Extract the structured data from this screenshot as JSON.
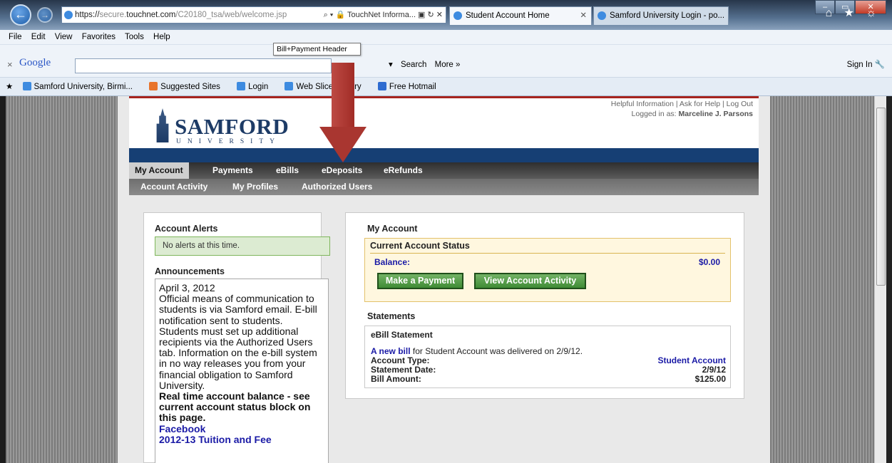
{
  "browser": {
    "address_prefix": "https://",
    "address_dim": "secure.",
    "address_domain": "touchnet.com",
    "address_path": "/C20180_tsa/web/welcome.jsp",
    "address_right": "⌕ ▾ 🔒 TouchNet Informa... ▣ ↻ ✕",
    "tabs": [
      {
        "label": "Student Account Home"
      },
      {
        "label": "Samford University Login - po..."
      }
    ],
    "window_buttons": [
      "–",
      "▭",
      "✕"
    ],
    "right_icons": "⌂ ★ ☼"
  },
  "menubar": {
    "items": [
      "File",
      "Edit",
      "View",
      "Favorites",
      "Tools",
      "Help"
    ]
  },
  "googlebar": {
    "close": "×",
    "logo": "Google",
    "search": "Search",
    "more": "More »",
    "signin": "Sign In"
  },
  "favorites": {
    "items": [
      {
        "label": "Samford University, Birmi...",
        "color": "#3d8be0"
      },
      {
        "label": "Suggested Sites",
        "color": "#e8742b"
      },
      {
        "label": "Login",
        "color": "#3d8be0"
      },
      {
        "label": "Web Slice Gallery",
        "color": "#3d8be0"
      },
      {
        "label": "Free Hotmail",
        "color": "#2d6bd0"
      }
    ]
  },
  "header": {
    "logo_name": "SAMFORD",
    "logo_sub": "UNIVERSITY",
    "links": "Helpful Information | Ask for Help | Log Out",
    "logged_in_label": "Logged in as:",
    "logged_in_user": "Marceline J. Parsons",
    "tooltip": "Bill+Payment Header"
  },
  "nav": {
    "tabs": [
      "My Account",
      "Payments",
      "eBills",
      "eDeposits",
      "eRefunds"
    ],
    "subtabs": [
      "Account Activity",
      "My Profiles",
      "Authorized Users"
    ]
  },
  "left": {
    "alerts_title": "Account Alerts",
    "alerts_text": "No alerts at this time.",
    "ann_title": "Announcements",
    "ann_date": "April 3, 2012",
    "ann_body": "Official means of communication to students is via Samford email. E-bill notification sent to students. Students must set up additional recipients via the Authorized Users tab. Information on the e-bill system in no way releases you from your financial obligation to Samford University.",
    "ann_bold": "Real time account balance - see current account status block on this page.",
    "ann_link1": "Facebook",
    "ann_link2": "2012-13 Tuition and Fee"
  },
  "right": {
    "title": "My Account",
    "status_title": "Current Account Status",
    "balance_label": "Balance:",
    "balance_value": "$0.00",
    "pay_button": "Make a Payment",
    "activity_button": "View Account Activity",
    "stmt_title": "Statements",
    "ebill_title": "eBill Statement",
    "new_bill_link": "A new bill",
    "new_bill_rest": "for Student Account was delivered on 2/9/12.",
    "rows": [
      {
        "label": "Account Type:",
        "value": "Student Account"
      },
      {
        "label": "Statement Date:",
        "value": "2/9/12"
      },
      {
        "label": "Bill Amount:",
        "value": "$125.00"
      }
    ]
  }
}
